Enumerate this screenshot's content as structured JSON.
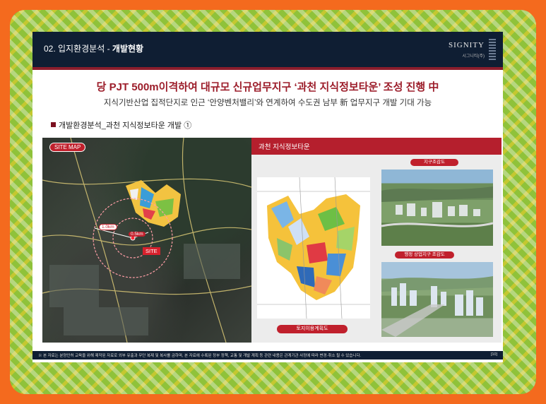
{
  "header": {
    "section_title_prefix": "02. 입지환경분석 - ",
    "section_title_main": "개발현황",
    "logo_text": "SIGNITY",
    "logo_sub": "시그니티(주)"
  },
  "headline": "당 PJT 500m이격하여 대규모 신규업무지구 ‘과천 지식정보타운’ 조성 진행 中",
  "subheadline": "지식기반산업 집적단지로 인근 ‘안양벤처밸리’와 연계하여 수도권 남부 新 업무지구 개발 기대 가능",
  "section_label": "개발환경분석_과천 지식정보타운 개발 ①",
  "site_map": {
    "badge": "SITE MAP",
    "ring_outer_label": "1.0km",
    "ring_inner_label": "0.5km",
    "site_label": "SITE"
  },
  "panel": {
    "title": "과천 지식정보타운",
    "plan_caption": "토지이용계획도",
    "photo1_caption": "지구조감도",
    "photo2_caption": "행정 상업지구 조감도"
  },
  "footer": {
    "note": "※ 본 자료는 분양인허 교육을 위해 제작된 자료로 외부 유출과 무단 복제 및 복사를 금하며, 본 자료에 수록된 정부 정책, 교통 및 개발 계획 등 관련 내용은 관계기관 사정에 따라 변경·취소 될 수 있습니다.",
    "page": "[10]"
  },
  "colors": {
    "page_bg": "#f46a1e",
    "frame": "#8fc23a",
    "header_navy": "#0f1e33",
    "accent_red": "#b51f2d"
  }
}
